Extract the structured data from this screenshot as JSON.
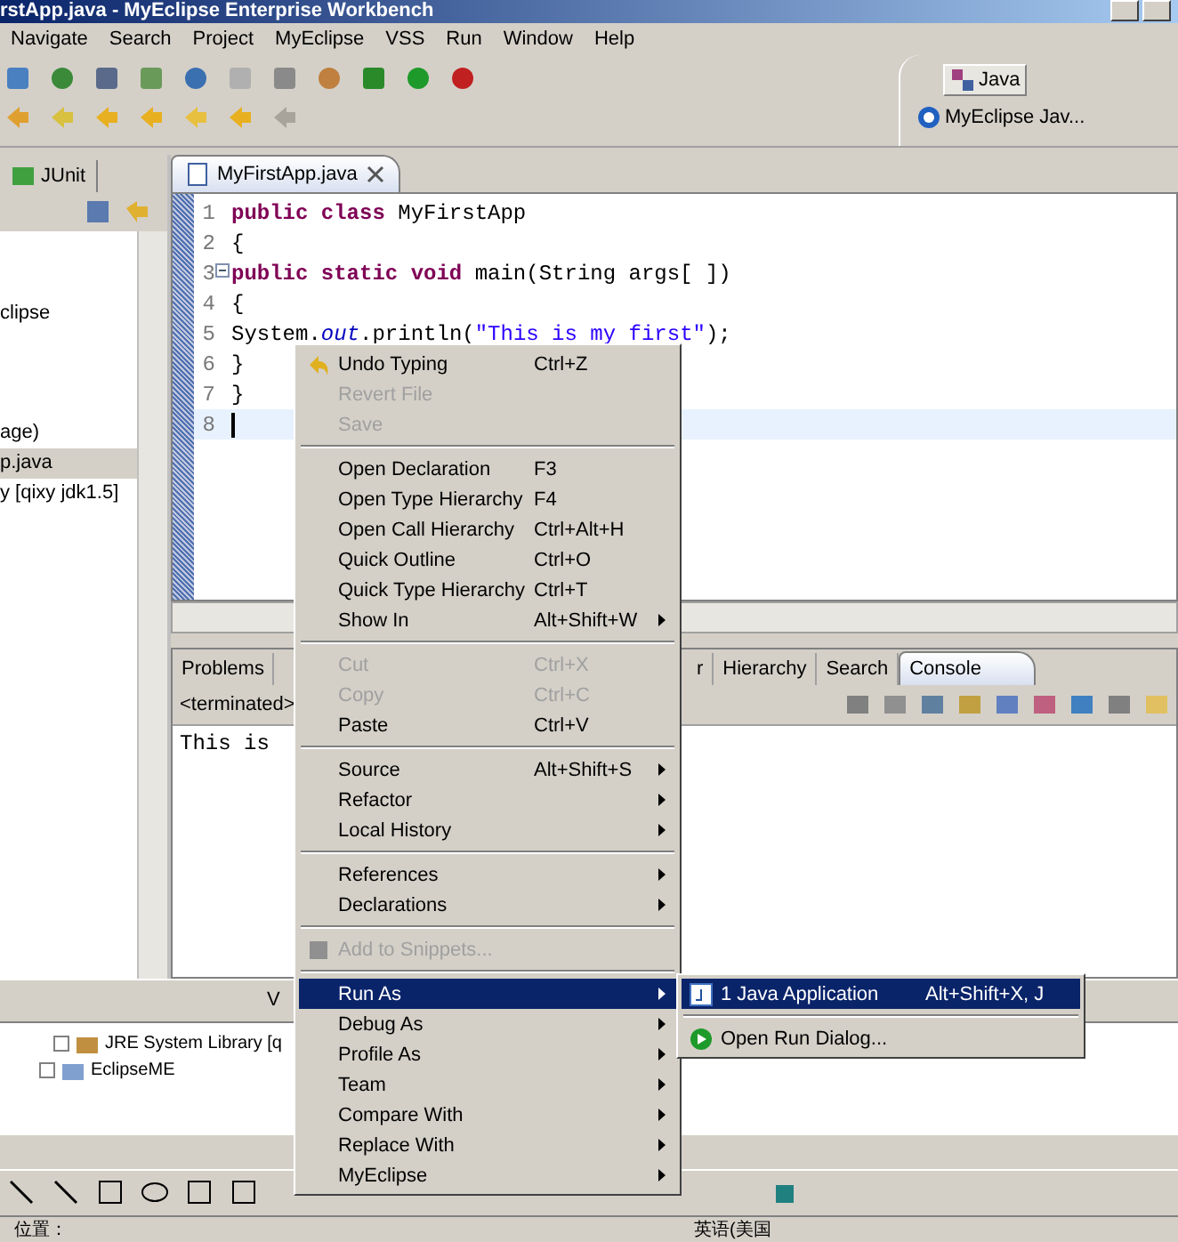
{
  "title": "rstApp.java - MyEclipse Enterprise Workbench",
  "menu_bar": [
    "Navigate",
    "Search",
    "Project",
    "MyEclipse",
    "VSS",
    "Run",
    "Window",
    "Help"
  ],
  "perspectives": [
    {
      "label": "Java",
      "selected": true
    },
    {
      "label": "MyEclipse Jav...",
      "selected": false
    }
  ],
  "left_view": {
    "tab": "JUnit",
    "tree": [
      {
        "label": "clipse",
        "selected": false
      },
      {
        "label": "age)",
        "selected": false
      },
      {
        "label": "p.java",
        "selected": true
      },
      {
        "label": "y [qixy jdk1.5]",
        "selected": false
      }
    ]
  },
  "editor": {
    "tab": "MyFirstApp.java",
    "lines": [
      {
        "number": "1",
        "current": false,
        "fold": false,
        "tokens": [
          {
            "text": "public class ",
            "kind": "keyword"
          },
          {
            "text": "MyFirstApp",
            "kind": "plain"
          }
        ]
      },
      {
        "number": "2",
        "current": false,
        "fold": false,
        "tokens": [
          {
            "text": "{",
            "kind": "plain"
          }
        ]
      },
      {
        "number": "3",
        "current": false,
        "fold": true,
        "tokens": [
          {
            "text": "public static void ",
            "kind": "keyword"
          },
          {
            "text": "main(String args[ ])",
            "kind": "plain"
          }
        ]
      },
      {
        "number": "4",
        "current": false,
        "fold": false,
        "tokens": [
          {
            "text": "{",
            "kind": "plain"
          }
        ]
      },
      {
        "number": "5",
        "current": false,
        "fold": false,
        "tokens": [
          {
            "text": "System.",
            "kind": "plain"
          },
          {
            "text": "out",
            "kind": "field"
          },
          {
            "text": ".println(",
            "kind": "plain"
          },
          {
            "text": "\"This is my first\"",
            "kind": "string"
          },
          {
            "text": ");",
            "kind": "plain"
          }
        ]
      },
      {
        "number": "6",
        "current": false,
        "fold": false,
        "tokens": [
          {
            "text": "}",
            "kind": "plain"
          }
        ]
      },
      {
        "number": "7",
        "current": false,
        "fold": false,
        "tokens": [
          {
            "text": "}",
            "kind": "plain"
          }
        ]
      },
      {
        "number": "8",
        "current": true,
        "fold": false
      }
    ]
  },
  "bottom_view": {
    "tabs": [
      {
        "label": "Problems",
        "selected": false
      },
      {
        "label": "r",
        "selected": false
      },
      {
        "label": "Hierarchy",
        "selected": false
      },
      {
        "label": "Search",
        "selected": false
      },
      {
        "label": "Console",
        "selected": true
      }
    ],
    "status": "<terminated>",
    "output": "This is"
  },
  "strip_tab": "V",
  "lower_tree": [
    "JRE System Library [q",
    "EclipseME"
  ],
  "status_bar": {
    "position": "位置：",
    "language": "英语(美国"
  },
  "context_menu": [
    {
      "kind": "item",
      "label": "Undo Typing",
      "shortcut": "Ctrl+Z",
      "disabled": false,
      "submenu": false,
      "selected": false
    },
    {
      "kind": "item",
      "label": "Revert File",
      "disabled": true,
      "submenu": false,
      "selected": false
    },
    {
      "kind": "item",
      "label": "Save",
      "disabled": true,
      "submenu": false,
      "selected": false
    },
    {
      "kind": "separator"
    },
    {
      "kind": "item",
      "label": "Open Declaration",
      "shortcut": "F3",
      "disabled": false,
      "submenu": false,
      "selected": false
    },
    {
      "kind": "item",
      "label": "Open Type Hierarchy",
      "shortcut": "F4",
      "disabled": false,
      "submenu": false,
      "selected": false
    },
    {
      "kind": "item",
      "label": "Open Call Hierarchy",
      "shortcut": "Ctrl+Alt+H",
      "disabled": false,
      "submenu": false,
      "selected": false
    },
    {
      "kind": "item",
      "label": "Quick Outline",
      "shortcut": "Ctrl+O",
      "disabled": false,
      "submenu": false,
      "selected": false
    },
    {
      "kind": "item",
      "label": "Quick Type Hierarchy",
      "shortcut": "Ctrl+T",
      "disabled": false,
      "submenu": false,
      "selected": false
    },
    {
      "kind": "item",
      "label": "Show In",
      "shortcut": "Alt+Shift+W",
      "disabled": false,
      "submenu": true,
      "selected": false
    },
    {
      "kind": "separator"
    },
    {
      "kind": "item",
      "label": "Cut",
      "shortcut": "Ctrl+X",
      "disabled": true,
      "submenu": false,
      "selected": false
    },
    {
      "kind": "item",
      "label": "Copy",
      "shortcut": "Ctrl+C",
      "disabled": true,
      "submenu": false,
      "selected": false
    },
    {
      "kind": "item",
      "label": "Paste",
      "shortcut": "Ctrl+V",
      "disabled": false,
      "submenu": false,
      "selected": false
    },
    {
      "kind": "separator"
    },
    {
      "kind": "item",
      "label": "Source",
      "shortcut": "Alt+Shift+S",
      "disabled": false,
      "submenu": true,
      "selected": false
    },
    {
      "kind": "item",
      "label": "Refactor",
      "disabled": false,
      "submenu": true,
      "selected": false
    },
    {
      "kind": "item",
      "label": "Local History",
      "disabled": false,
      "submenu": true,
      "selected": false
    },
    {
      "kind": "separator"
    },
    {
      "kind": "item",
      "label": "References",
      "disabled": false,
      "submenu": true,
      "selected": false
    },
    {
      "kind": "item",
      "label": "Declarations",
      "disabled": false,
      "submenu": true,
      "selected": false
    },
    {
      "kind": "separator"
    },
    {
      "kind": "item",
      "label": "Add to Snippets...",
      "disabled": true,
      "submenu": false,
      "selected": false
    },
    {
      "kind": "separator"
    },
    {
      "kind": "item",
      "label": "Run As",
      "disabled": false,
      "submenu": true,
      "selected": true
    },
    {
      "kind": "item",
      "label": "Debug As",
      "disabled": false,
      "submenu": true,
      "selected": false
    },
    {
      "kind": "item",
      "label": "Profile As",
      "disabled": false,
      "submenu": true,
      "selected": false
    },
    {
      "kind": "item",
      "label": "Team",
      "disabled": false,
      "submenu": true,
      "selected": false
    },
    {
      "kind": "item",
      "label": "Compare With",
      "disabled": false,
      "submenu": true,
      "selected": false
    },
    {
      "kind": "item",
      "label": "Replace With",
      "disabled": false,
      "submenu": true,
      "selected": false
    },
    {
      "kind": "item",
      "label": "MyEclipse",
      "disabled": false,
      "submenu": true,
      "selected": false
    }
  ],
  "submenu": [
    {
      "kind": "item",
      "label": "1 Java Application",
      "shortcut": "Alt+Shift+X, J",
      "selected": true
    },
    {
      "kind": "separator"
    },
    {
      "kind": "item",
      "label": "Open Run Dialog...",
      "selected": false
    }
  ]
}
